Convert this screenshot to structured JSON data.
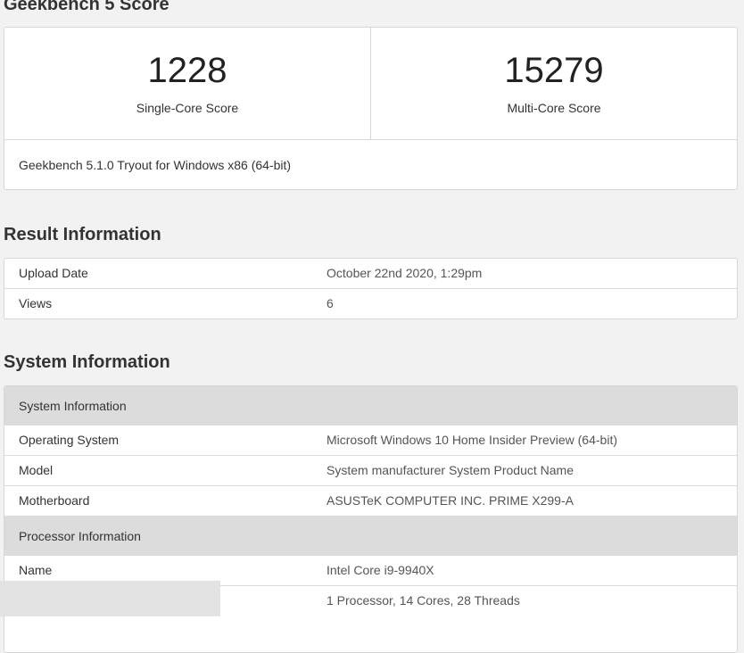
{
  "geekbench": {
    "title": "Geekbench 5 Score",
    "single_core_score": "1228",
    "single_core_label": "Single-Core Score",
    "multi_core_score": "15279",
    "multi_core_label": "Multi-Core Score",
    "version_text": "Geekbench 5.1.0 Tryout for Windows x86 (64-bit)"
  },
  "result_info": {
    "title": "Result Information",
    "rows": [
      {
        "key": "Upload Date",
        "value": "October 22nd 2020, 1:29pm"
      },
      {
        "key": "Views",
        "value": "6"
      }
    ]
  },
  "system_info": {
    "title": "System Information",
    "groups": [
      {
        "header": "System Information",
        "rows": [
          {
            "key": "Operating System",
            "value": "Microsoft Windows 10 Home Insider Preview (64-bit)"
          },
          {
            "key": "Model",
            "value": "System manufacturer System Product Name"
          },
          {
            "key": "Motherboard",
            "value": "ASUSTeK COMPUTER INC. PRIME X299-A"
          }
        ]
      },
      {
        "header": "Processor Information",
        "rows": [
          {
            "key": "Name",
            "value": "Intel Core i9-9940X"
          },
          {
            "key": "",
            "value": "1 Processor, 14 Cores, 28 Threads"
          }
        ]
      }
    ]
  }
}
